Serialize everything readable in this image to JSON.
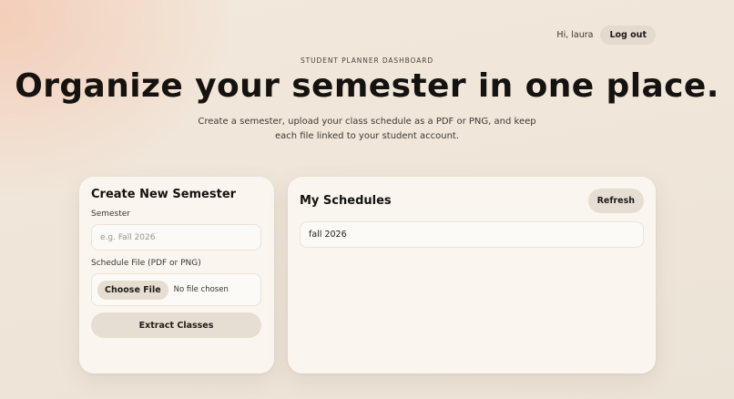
{
  "header": {
    "greeting": "Hi, laura",
    "logout_label": "Log out"
  },
  "hero": {
    "eyebrow": "STUDENT PLANNER DASHBOARD",
    "title": "Organize your semester in one place.",
    "subtitle_line1": "Create a semester, upload your class schedule as a PDF or PNG, and keep",
    "subtitle_line2": "each file linked to your student account."
  },
  "create_semester": {
    "title": "Create New Semester",
    "semester_label": "Semester",
    "semester_value": "",
    "semester_placeholder": "e.g. Fall 2026",
    "file_label": "Schedule File (PDF or PNG)",
    "choose_file_label": "Choose File",
    "file_status": "No file chosen",
    "submit_label": "Extract Classes"
  },
  "schedules": {
    "title": "My Schedules",
    "refresh_label": "Refresh",
    "items": [
      "fall 2026"
    ]
  }
}
